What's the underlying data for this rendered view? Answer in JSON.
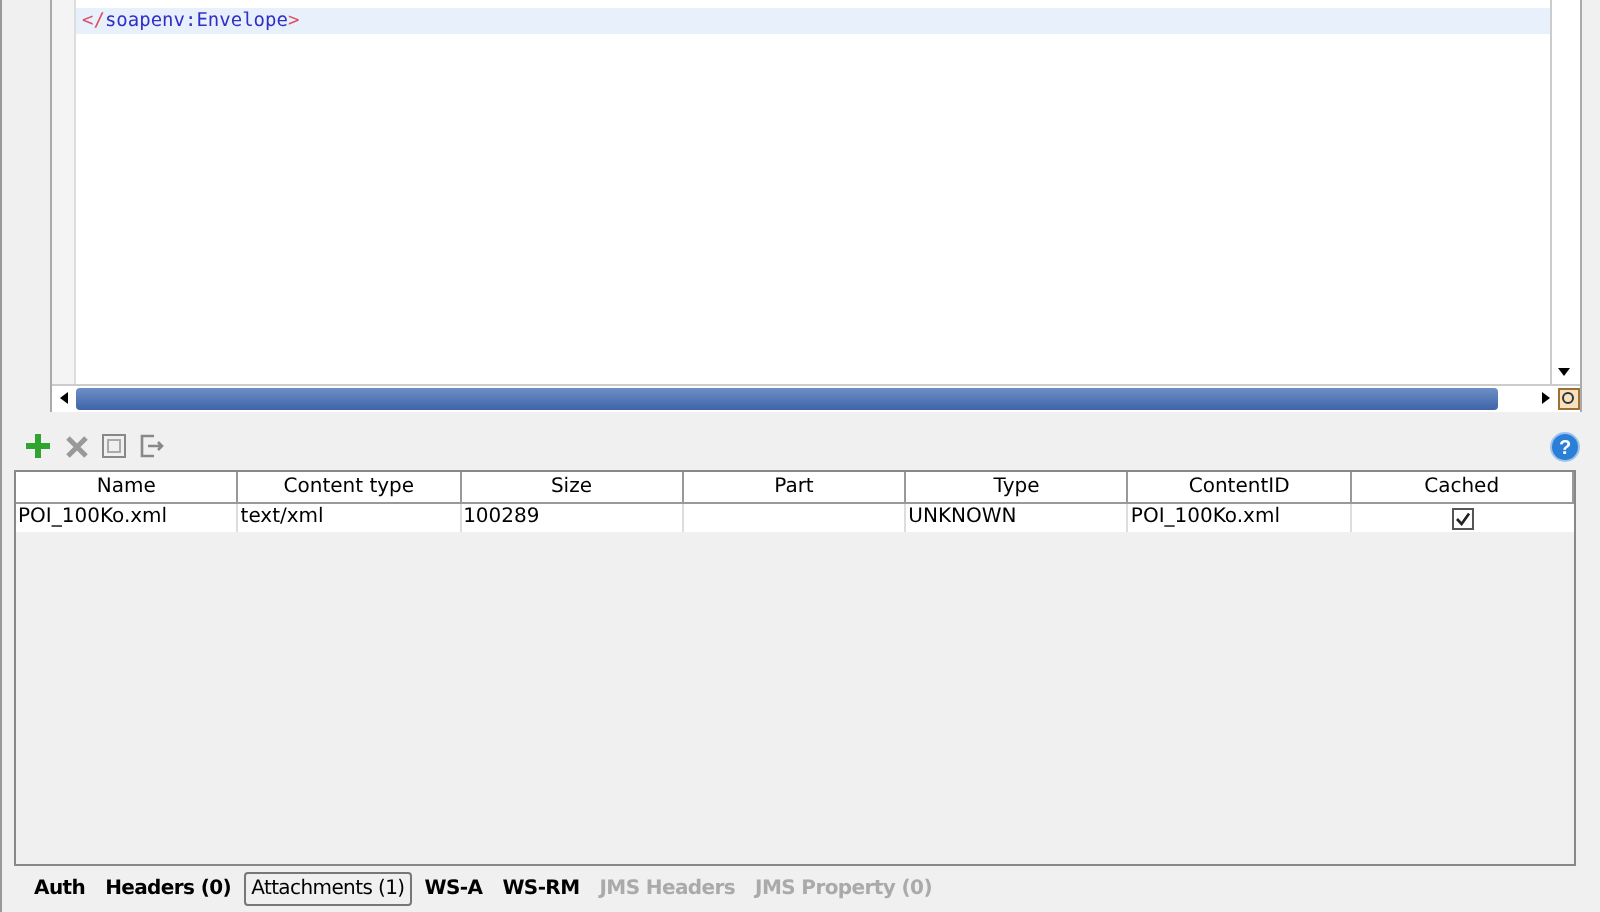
{
  "editor": {
    "lines": [
      {
        "open": "</",
        "tag": "soapenv:Envelope",
        "close": ">",
        "highlighted": true
      }
    ]
  },
  "attachments": {
    "columns": [
      "Name",
      "Content type",
      "Size",
      "Part",
      "Type",
      "ContentID",
      "Cached"
    ],
    "rows": [
      {
        "name": "POI_100Ko.xml",
        "content_type": "text/xml",
        "size": "100289",
        "part": "",
        "type": "UNKNOWN",
        "content_id": "POI_100Ko.xml",
        "cached": true
      }
    ]
  },
  "help_label": "?",
  "tabs": [
    {
      "label": "Auth",
      "selected": false,
      "disabled": false
    },
    {
      "label": "Headers (0)",
      "selected": false,
      "disabled": false
    },
    {
      "label": "Attachments (1)",
      "selected": true,
      "disabled": false
    },
    {
      "label": "WS-A",
      "selected": false,
      "disabled": false
    },
    {
      "label": "WS-RM",
      "selected": false,
      "disabled": false
    },
    {
      "label": "JMS Headers",
      "selected": false,
      "disabled": true
    },
    {
      "label": "JMS Property (0)",
      "selected": false,
      "disabled": true
    }
  ]
}
